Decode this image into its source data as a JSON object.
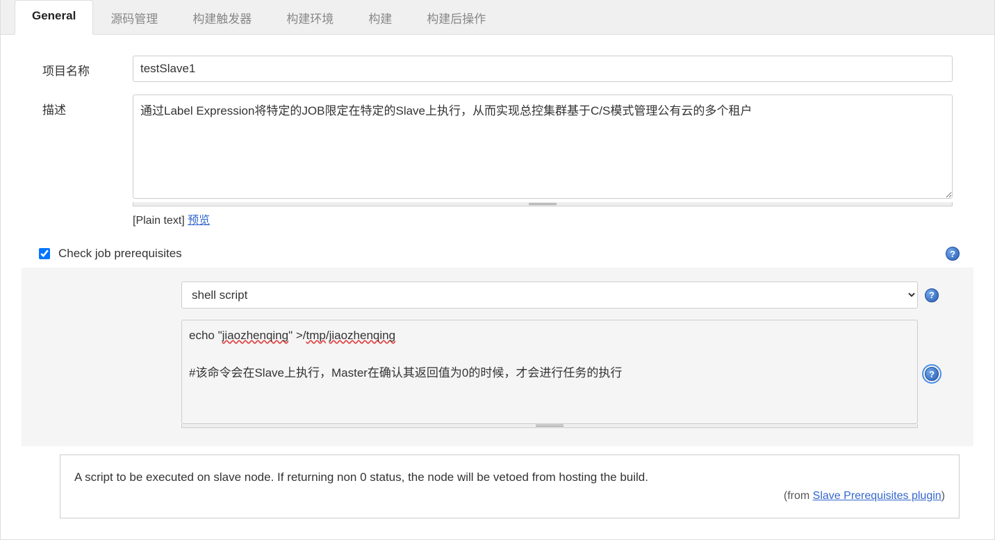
{
  "tabs": [
    {
      "label": "General",
      "active": true
    },
    {
      "label": "源码管理",
      "active": false
    },
    {
      "label": "构建触发器",
      "active": false
    },
    {
      "label": "构建环境",
      "active": false
    },
    {
      "label": "构建",
      "active": false
    },
    {
      "label": "构建后操作",
      "active": false
    }
  ],
  "form": {
    "projectName": {
      "label": "项目名称",
      "value": "testSlave1"
    },
    "description": {
      "label": "描述",
      "value": "通过Label Expression将特定的JOB限定在特定的Slave上执行，从而实现总控集群基于C/S模式管理公有云的多个租户",
      "plainTextPrefix": "[Plain text] ",
      "previewLink": "预览"
    },
    "checkPrereq": {
      "label": "Check job prerequisites",
      "checked": true
    },
    "scriptType": {
      "selected": "shell script"
    },
    "scriptContent": {
      "line1_echo": "echo \"",
      "line1_word1": "jiaozhenqing",
      "line1_mid": "\" >/",
      "line1_word2": "tmp",
      "line1_slash": "/",
      "line1_word3": "jiaozhenqing",
      "line2": "#该命令会在Slave上执行，Master在确认其返回值为0的时候，才会进行任务的执行"
    },
    "infoBox": {
      "text": "A script to be executed on slave node. If returning non 0 status, the node will be vetoed from hosting the build.",
      "creditPrefix": "(from ",
      "creditLink": "Slave Prerequisites plugin",
      "creditSuffix": ")"
    }
  }
}
